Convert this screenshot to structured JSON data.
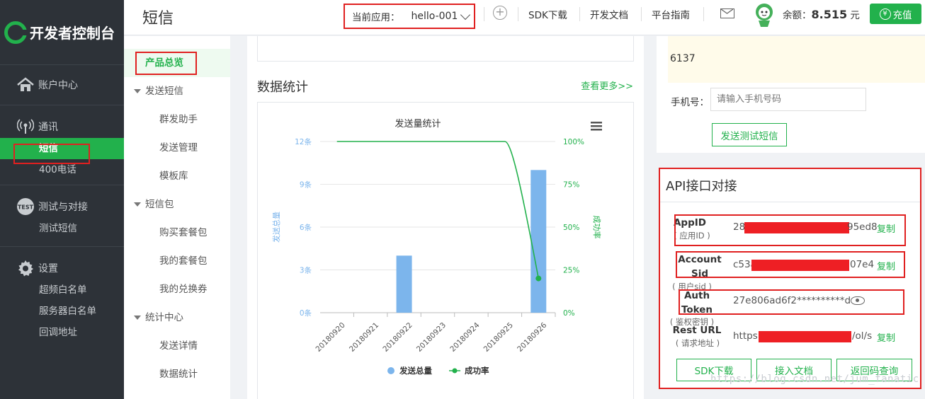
{
  "sidebar": {
    "logo_text": "开发者控制台",
    "groups": [
      {
        "title": "账户中心",
        "icon": "home-icon",
        "items": []
      },
      {
        "title": "通讯",
        "icon": "signal-icon",
        "items": [
          "短信",
          "400电话"
        ]
      },
      {
        "title": "测试与对接",
        "icon": "test-badge-icon",
        "items": [
          "测试短信"
        ]
      },
      {
        "title": "设置",
        "icon": "gear-icon",
        "items": [
          "超频白名单",
          "服务器白名单",
          "回调地址"
        ]
      }
    ]
  },
  "header": {
    "page_title": "短信",
    "current_app_label": "当前应用：",
    "current_app_value": "hello-001",
    "links": [
      "SDK下载",
      "开发文档",
      "平台指南"
    ],
    "balance_label": "余额：",
    "balance_value": "8.515",
    "balance_unit": "元",
    "recharge_label": "充值",
    "recharge_icon": "¥"
  },
  "subnav": {
    "current": "产品总览",
    "sections": [
      {
        "title": "发送短信",
        "items": [
          "群发助手",
          "发送管理",
          "模板库"
        ]
      },
      {
        "title": "短信包",
        "items": [
          "购买套餐包",
          "我的套餐包",
          "我的兑换券"
        ]
      },
      {
        "title": "统计中心",
        "items": [
          "发送详情",
          "数据统计"
        ]
      }
    ]
  },
  "stats": {
    "title": "数据统计",
    "more_link": "查看更多>>",
    "menu_icon": "hamburger-menu-icon"
  },
  "chart_data": {
    "type": "bar",
    "title": "发送量统计",
    "categories": [
      "20180920",
      "20180921",
      "20180922",
      "20180923",
      "20180924",
      "20180925",
      "20180926"
    ],
    "series": [
      {
        "name": "发送总量",
        "type": "bar",
        "axis": "left",
        "color": "#7cb5ec",
        "values": [
          0,
          0,
          4,
          0,
          0,
          0,
          10
        ]
      },
      {
        "name": "成功率",
        "type": "line",
        "axis": "right",
        "color": "#22b14c",
        "values": [
          100,
          100,
          100,
          100,
          100,
          100,
          20
        ]
      }
    ],
    "ylabel": "发送总量",
    "ylabel_right": "成功率",
    "y_ticks": [
      "0条",
      "3条",
      "6条",
      "9条",
      "12条"
    ],
    "y_right_ticks": [
      "0%",
      "25%",
      "50%",
      "75%",
      "100%"
    ],
    "ylim": [
      0,
      12
    ],
    "ylim_right": [
      0,
      100
    ],
    "grid": true,
    "legend_position": "bottom"
  },
  "right_panel": {
    "code_text": "6137",
    "phone_label": "手机号：",
    "phone_placeholder": "请输入手机号码",
    "test_button": "发送测试短信"
  },
  "api": {
    "title": "API接口对接",
    "rows": [
      {
        "key": "AppID",
        "hint": "( 应用ID )",
        "prefix": "28",
        "suffix": "95ed8",
        "action": "复制"
      },
      {
        "key": "Account Sid",
        "hint": "( 用户sid )",
        "prefix": "c53a",
        "suffix": "07e4",
        "action": "复制"
      },
      {
        "key": "Auth Token",
        "hint": "( 鉴权密钥 )",
        "prefix": "27e806ad6f2**********d",
        "suffix": "",
        "action": ""
      },
      {
        "key": "Rest URL",
        "hint": "( 请求地址 )",
        "prefix": "https:",
        "suffix": "/ol/s",
        "action": "复制"
      }
    ],
    "buttons": [
      "SDK下载",
      "接入文档",
      "返回码查询"
    ]
  },
  "watermark": "https://blog.csdn.net/jum_fanatic",
  "colors": {
    "brand": "#22b14c",
    "sidebar_bg": "#2d3238",
    "highlight": "#e02020",
    "bar": "#7cb5ec"
  }
}
